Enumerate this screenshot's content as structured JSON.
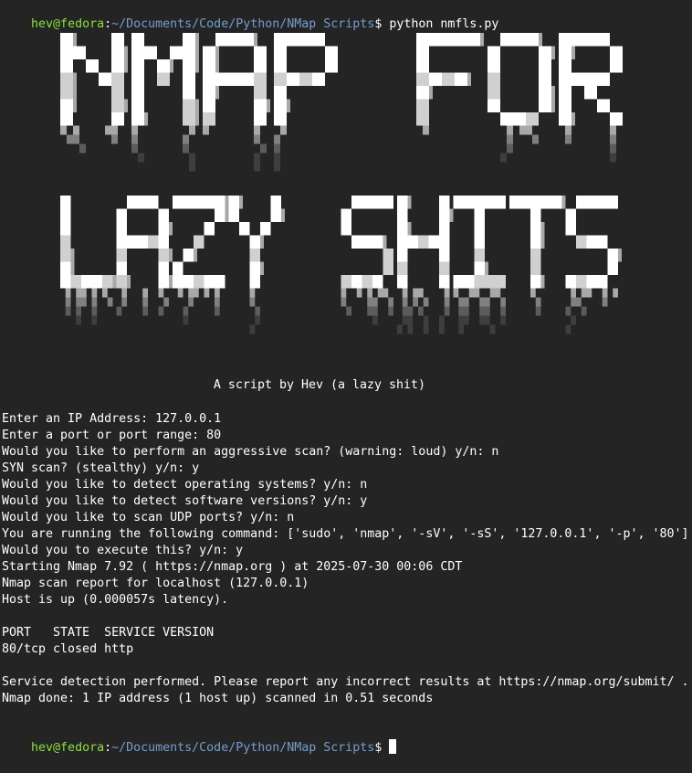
{
  "prompt": {
    "user_host": "hev@fedora",
    "separator": ":",
    "path": "~/Documents/Code/Python/NMap Scripts",
    "symbol": "$ ",
    "command": "python nmfls.py"
  },
  "banner": {
    "line1": "NMAP FOR",
    "line2": "LAZY SHITS",
    "subtitle": "A script by Hev (a lazy shit)"
  },
  "output": [
    "Enter an IP Address: 127.0.0.1",
    "Enter a port or port range: 80",
    "Would you like to perform an aggressive scan? (warning: loud) y/n: n",
    "SYN scan? (stealthy) y/n: y",
    "Would you like to detect operating systems? y/n: n",
    "Would you like to detect software versions? y/n: y",
    "Would you like to scan UDP ports? y/n: n",
    "You are running the following command: ['sudo', 'nmap', '-sV', '-sS', '127.0.0.1', '-p', '80']",
    "Would you to execute this? y/n: y",
    "Starting Nmap 7.92 ( https://nmap.org ) at 2025-07-30 00:06 CDT",
    "Nmap scan report for localhost (127.0.0.1)",
    "Host is up (0.000057s latency).",
    "",
    "PORT   STATE  SERVICE VERSION",
    "80/tcp closed http",
    "",
    "Service detection performed. Please report any incorrect results at https://nmap.org/submit/ .",
    "Nmap done: 1 IP address (1 host up) scanned in 0.51 seconds"
  ],
  "final_prompt": {
    "user_host": "hev@fedora",
    "separator": ":",
    "path": "~/Documents/Code/Python/NMap Scripts",
    "symbol": "$ "
  },
  "colors": {
    "background": "#242424",
    "text": "#ffffff",
    "prompt_user": "#8ae234",
    "prompt_path": "#729fcf",
    "banner_shades": [
      "#ffffff",
      "#d0d0d0",
      "#a8a8a8",
      "#808080",
      "#5c5c5c",
      "#3e3e3e"
    ]
  }
}
